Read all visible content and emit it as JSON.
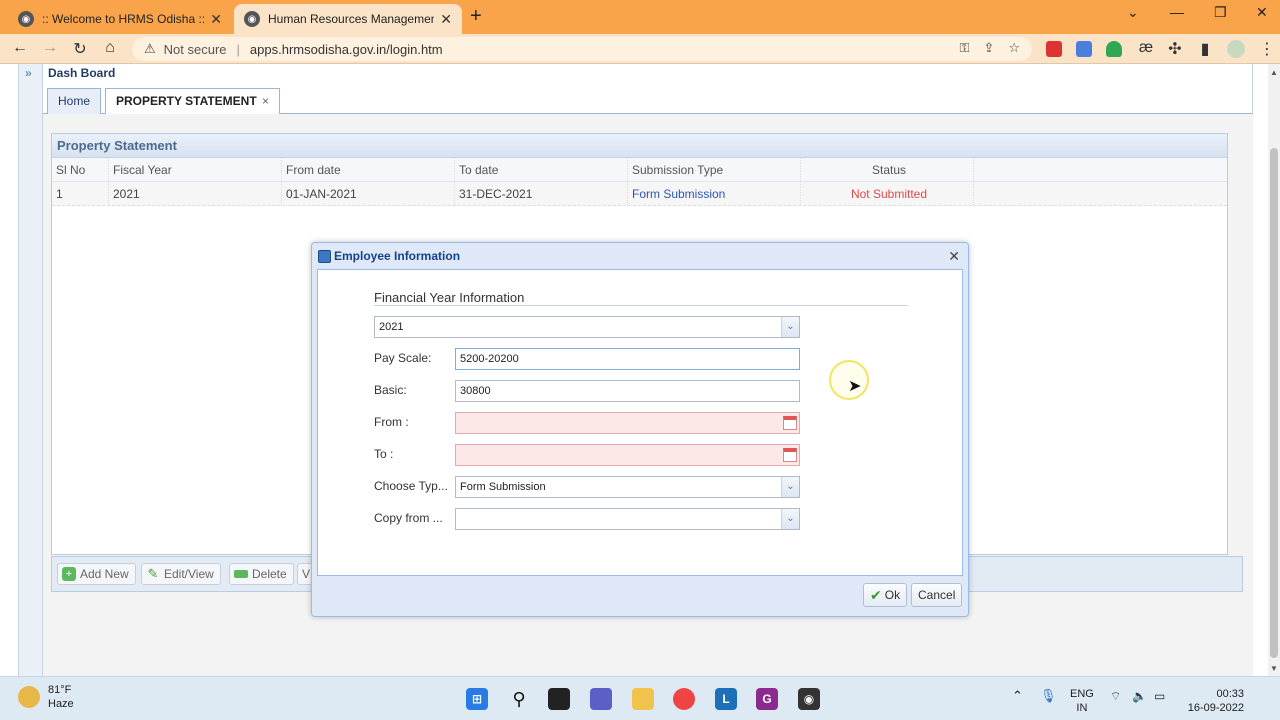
{
  "browser": {
    "tabs": [
      {
        "title": ":: Welcome to HRMS Odisha ::",
        "active": false
      },
      {
        "title": "Human Resources Management",
        "active": true
      }
    ],
    "address": {
      "security": "Not secure",
      "url": "apps.hrmsodisha.gov.in/login.htm"
    }
  },
  "app": {
    "dashboard_title": "Dash Board",
    "tabs": [
      {
        "label": "Home"
      },
      {
        "label": "PROPERTY STATEMENT",
        "close": "×"
      }
    ],
    "grid": {
      "title": "Property Statement",
      "columns": [
        "Sl No",
        "Fiscal Year",
        "From date",
        "To date",
        "Submission Type",
        "Status"
      ],
      "rows": [
        [
          "1",
          "2021",
          "01-JAN-2021",
          "31-DEC-2021",
          "Form Submission",
          "Not Submitted"
        ]
      ]
    },
    "buttons": {
      "add": "Add New",
      "edit": "Edit/View",
      "delete": "Delete",
      "more": "V"
    }
  },
  "modal": {
    "title": "Employee Information",
    "section_title": "Financial Year Information",
    "fiscal_year": "2021",
    "fields": {
      "pay_scale_label": "Pay Scale:",
      "pay_scale_value": "5200-20200",
      "basic_label": "Basic:",
      "basic_value": "30800",
      "from_label": "From :",
      "from_value": "",
      "to_label": "To :",
      "to_value": "",
      "choose_type_label": "Choose Typ...",
      "choose_type_value": "Form Submission",
      "copy_from_label": "Copy from ...",
      "copy_from_value": ""
    },
    "ok_label": "Ok",
    "cancel_label": "Cancel"
  },
  "taskbar": {
    "weather_temp": "81°F",
    "weather_desc": "Haze",
    "lang_top": "ENG",
    "lang_bottom": "IN",
    "time": "00:33",
    "date": "16-09-2022"
  },
  "colors": {
    "chrome_orange": "#f9a44a",
    "status_red": "#e04a4a",
    "link_blue": "#2f55b0",
    "panel_title": "#15428b"
  }
}
